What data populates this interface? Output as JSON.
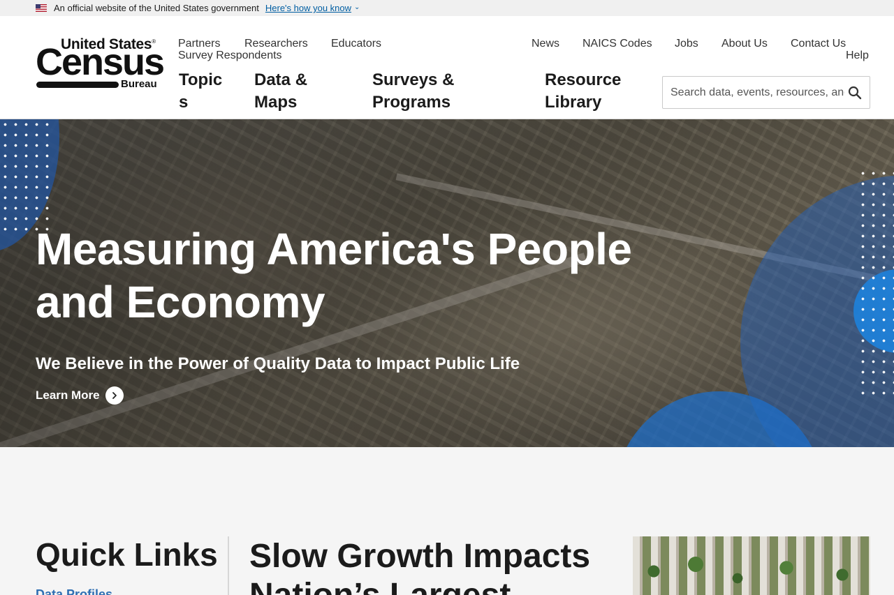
{
  "gov_banner": {
    "text": "An official website of the United States government",
    "link": "Here's how you know"
  },
  "logo": {
    "line1": "United States",
    "reg": "®",
    "line2": "Census",
    "line3": "Bureau"
  },
  "util_nav_left": [
    "Partners",
    "Researchers",
    "Educators",
    "Survey Respondents"
  ],
  "util_nav_right": [
    "News",
    "NAICS Codes",
    "Jobs",
    "About Us",
    "Contact Us",
    "Help"
  ],
  "main_nav": [
    "Topics",
    "Data & Maps",
    "Surveys & Programs",
    "Resource Library"
  ],
  "search": {
    "placeholder": "Search data, events, resources, and more"
  },
  "hero": {
    "title": "Measuring America's People and Economy",
    "subtitle": "We Believe in the Power of Quality Data to Impact Public Life",
    "cta": "Learn More"
  },
  "quick_links": {
    "title": "Quick Links",
    "items": [
      "Data Profiles"
    ]
  },
  "featured": {
    "title": "Slow Growth Impacts Nation’s Largest"
  },
  "colors": {
    "link": "#005ea2",
    "accent_blue": "#1f5fa8",
    "header_bg": "#ffffff"
  }
}
